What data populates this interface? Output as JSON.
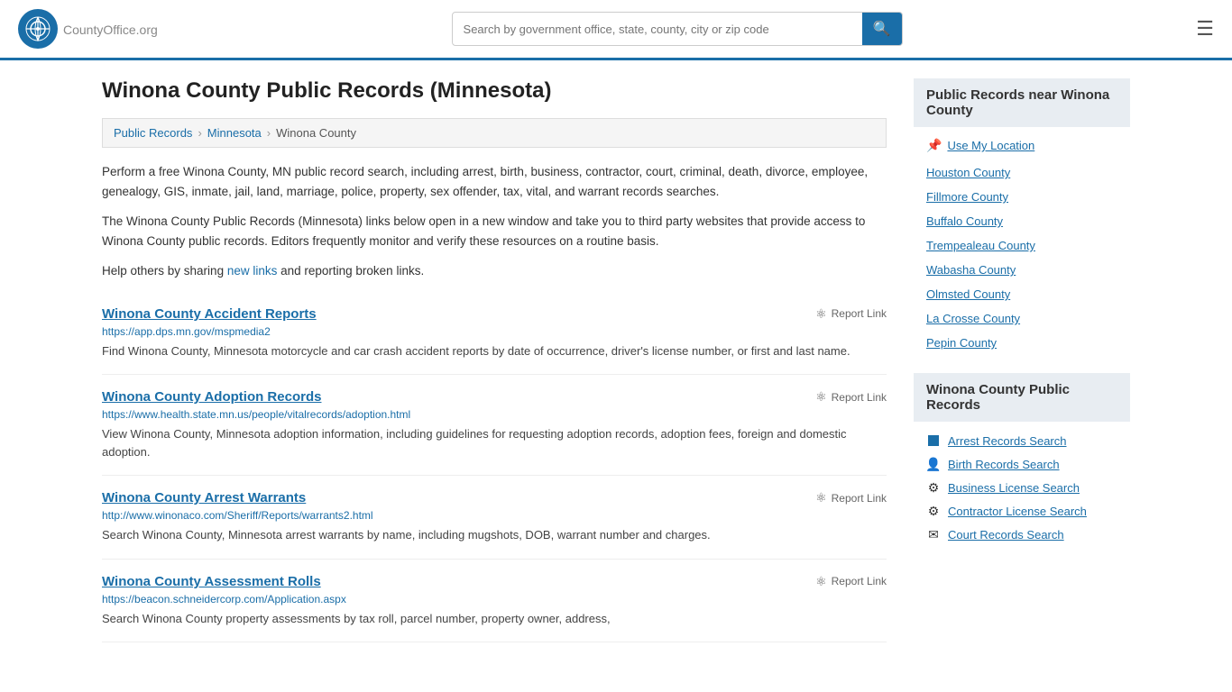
{
  "header": {
    "logo_text": "CountyOffice",
    "logo_suffix": ".org",
    "search_placeholder": "Search by government office, state, county, city or zip code",
    "search_value": ""
  },
  "page": {
    "title": "Winona County Public Records (Minnesota)",
    "breadcrumbs": [
      "Public Records",
      "Minnesota",
      "Winona County"
    ],
    "description1": "Perform a free Winona County, MN public record search, including arrest, birth, business, contractor, court, criminal, death, divorce, employee, genealogy, GIS, inmate, jail, land, marriage, police, property, sex offender, tax, vital, and warrant records searches.",
    "description2": "The Winona County Public Records (Minnesota) links below open in a new window and take you to third party websites that provide access to Winona County public records. Editors frequently monitor and verify these resources on a routine basis.",
    "description3_pre": "Help others by sharing ",
    "description3_link": "new links",
    "description3_post": " and reporting broken links."
  },
  "records": [
    {
      "title": "Winona County Accident Reports",
      "url": "https://app.dps.mn.gov/mspmedia2",
      "desc": "Find Winona County, Minnesota motorcycle and car crash accident reports by date of occurrence, driver's license number, or first and last name.",
      "report_label": "Report Link"
    },
    {
      "title": "Winona County Adoption Records",
      "url": "https://www.health.state.mn.us/people/vitalrecords/adoption.html",
      "desc": "View Winona County, Minnesota adoption information, including guidelines for requesting adoption records, adoption fees, foreign and domestic adoption.",
      "report_label": "Report Link"
    },
    {
      "title": "Winona County Arrest Warrants",
      "url": "http://www.winonaco.com/Sheriff/Reports/warrants2.html",
      "desc": "Search Winona County, Minnesota arrest warrants by name, including mugshots, DOB, warrant number and charges.",
      "report_label": "Report Link"
    },
    {
      "title": "Winona County Assessment Rolls",
      "url": "https://beacon.schneidercorp.com/Application.aspx",
      "desc": "Search Winona County property assessments by tax roll, parcel number, property owner, address,",
      "report_label": "Report Link"
    }
  ],
  "sidebar": {
    "nearby_header": "Public Records near Winona County",
    "use_location_label": "Use My Location",
    "nearby_counties": [
      "Houston County",
      "Fillmore County",
      "Buffalo County",
      "Trempealeau County",
      "Wabasha County",
      "Olmsted County",
      "La Crosse County",
      "Pepin County"
    ],
    "public_records_header": "Winona County Public Records",
    "public_records_links": [
      {
        "label": "Arrest Records Search",
        "icon": "square"
      },
      {
        "label": "Birth Records Search",
        "icon": "person"
      },
      {
        "label": "Business License Search",
        "icon": "gear"
      },
      {
        "label": "Contractor License Search",
        "icon": "gear"
      },
      {
        "label": "Court Records Search",
        "icon": "court"
      }
    ]
  }
}
